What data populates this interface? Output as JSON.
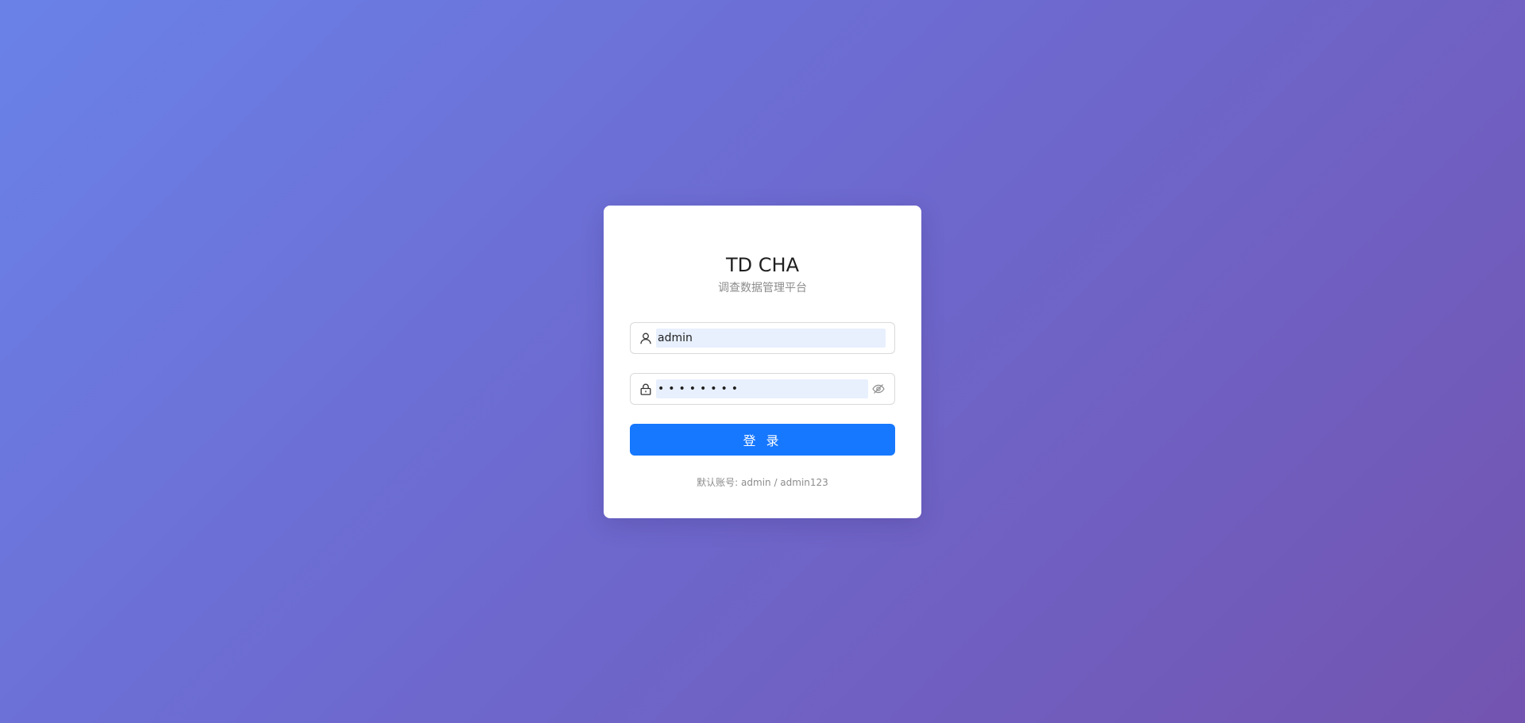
{
  "app": {
    "title": "TD CHA",
    "subtitle": "调查数据管理平台"
  },
  "form": {
    "username": {
      "value": "admin",
      "icon": "user-icon"
    },
    "password": {
      "value": "admin123",
      "icon": "lock-icon",
      "toggle_icon": "eye-invisible-icon"
    },
    "login_label": "登 录",
    "hint": "默认账号: admin / admin123"
  },
  "colors": {
    "primary": "#1677ff",
    "gradient_start": "#6a82e8",
    "gradient_end": "#7354b0",
    "autofill_bg": "#e8f0fe"
  }
}
